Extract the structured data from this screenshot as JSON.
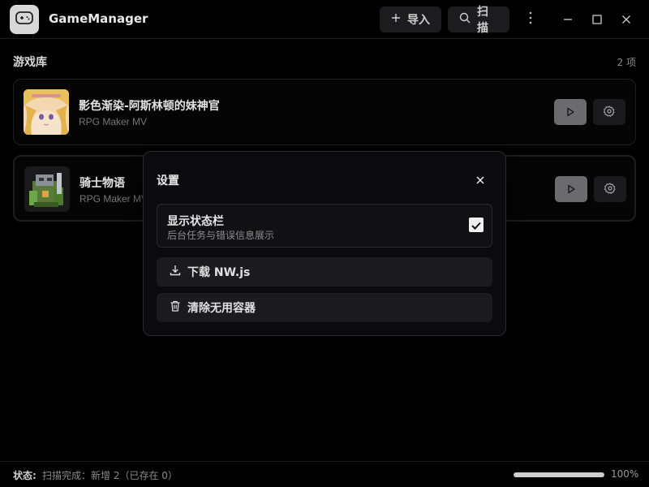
{
  "app": {
    "title": "GameManager"
  },
  "toolbar": {
    "import_label": "导入",
    "scan_label": "扫描"
  },
  "library": {
    "title": "游戏库",
    "count": "2 项",
    "games": [
      {
        "name": "影色渐染-阿斯林顿的妹神官",
        "engine": "RPG Maker MV"
      },
      {
        "name": "骑士物语",
        "engine": "RPG Maker MV"
      }
    ]
  },
  "settings_modal": {
    "title": "设置",
    "status_bar_toggle": {
      "label": "显示状态栏",
      "description": "后台任务与错误信息展示",
      "checked": true
    },
    "download_label": "下载 NW.js",
    "cleanup_label": "清除无用容器"
  },
  "statusbar": {
    "key": "状态:",
    "text": "扫描完成：新增 2（已存在 0）",
    "progress_label": "100%",
    "progress": 1.0
  },
  "colors": {
    "background": "#000000",
    "card_border": "#1f1f23",
    "play_button": "#6b6b6e"
  },
  "icons": [
    "gamepad-icon",
    "plus-icon",
    "search-icon",
    "more-vertical-icon",
    "minimize-icon",
    "maximize-icon",
    "close-icon",
    "play-icon",
    "gear-icon",
    "check-icon",
    "download-icon",
    "trash-icon"
  ]
}
